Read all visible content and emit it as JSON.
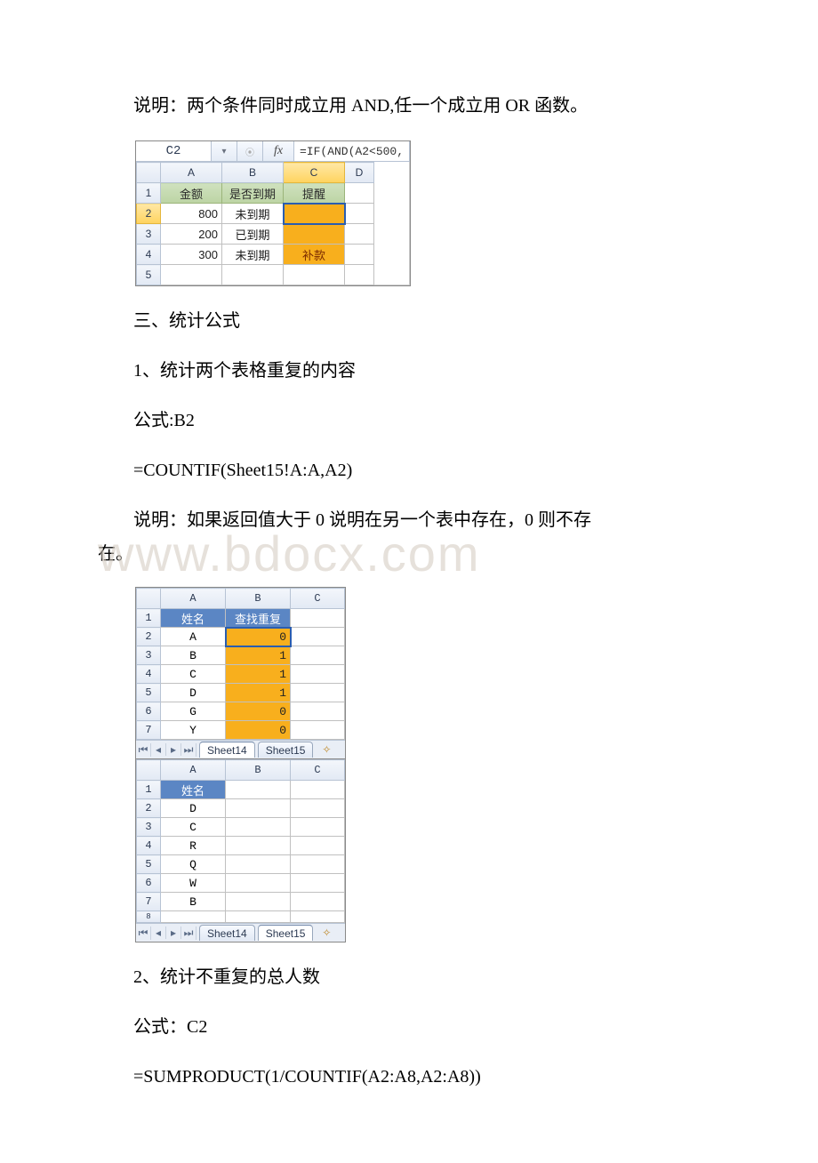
{
  "watermark": "www.bdocx.com",
  "text": {
    "note_and_or": "说明：两个条件同时成立用 AND,任一个成立用 OR 函数。",
    "sec3_heading": "三、统计公式",
    "sec3_item1": "1、统计两个表格重复的内容",
    "sec3_formula_label": "公式:B2",
    "sec3_formula": "=COUNTIF(Sheet15!A:A,A2)",
    "sec3_note_line1": "说明：如果返回值大于 0 说明在另一个表中存在，0 则不存",
    "sec3_note_line2": "在。",
    "sec3_item2": "2、统计不重复的总人数",
    "sec3_item2_label": "公式：C2",
    "sec3_item2_formula": "=SUMPRODUCT(1/COUNTIF(A2:A8,A2:A8))"
  },
  "fig1": {
    "formula_bar": {
      "cell_ref": "C2",
      "fx_label": "fx",
      "formula": "=IF(AND(A2<500,"
    },
    "cols": [
      "A",
      "B",
      "C",
      "D"
    ],
    "headers": [
      "金额",
      "是否到期",
      "提醒"
    ],
    "rows": [
      [
        "800",
        "未到期",
        ""
      ],
      [
        "200",
        "已到期",
        ""
      ],
      [
        "300",
        "未到期",
        "补款"
      ]
    ]
  },
  "fig2": {
    "tabs": [
      "Sheet14",
      "Sheet15"
    ],
    "s14": {
      "cols": [
        "A",
        "B",
        "C"
      ],
      "headers": [
        "姓名",
        "查找重复"
      ],
      "rows": [
        [
          "A",
          "0"
        ],
        [
          "B",
          "1"
        ],
        [
          "C",
          "1"
        ],
        [
          "D",
          "1"
        ],
        [
          "G",
          "0"
        ],
        [
          "Y",
          "0"
        ]
      ]
    },
    "s15": {
      "cols": [
        "A",
        "B",
        "C"
      ],
      "headers": [
        "姓名"
      ],
      "rows": [
        "D",
        "C",
        "R",
        "Q",
        "W",
        "B"
      ]
    }
  }
}
